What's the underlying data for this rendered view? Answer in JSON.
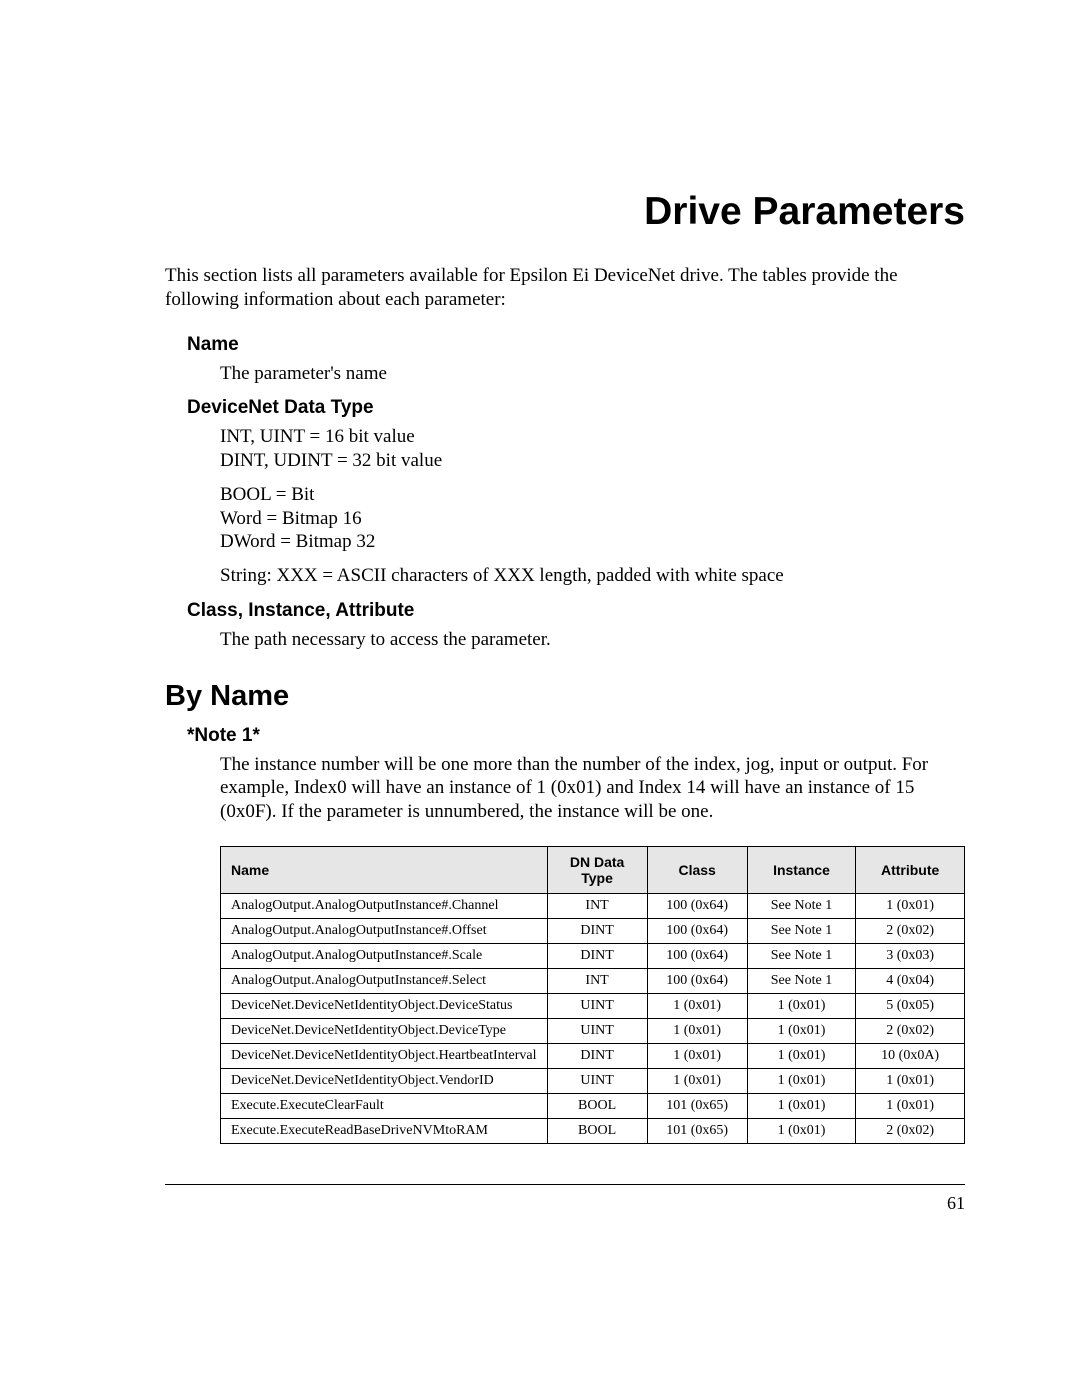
{
  "title": "Drive Parameters",
  "intro": "This section lists all parameters available for Epsilon Ei DeviceNet drive. The tables provide the following information about each parameter:",
  "sections": {
    "name": {
      "heading": "Name",
      "body": "The parameter's name"
    },
    "dataType": {
      "heading": "DeviceNet Data Type",
      "line1": "INT, UINT = 16 bit value",
      "line2": "DINT, UDINT = 32 bit value",
      "line3": "BOOL = Bit",
      "line4": "Word = Bitmap 16",
      "line5": "DWord = Bitmap 32",
      "line6": "String: XXX = ASCII characters of XXX length, padded with white space"
    },
    "cia": {
      "heading": "Class, Instance, Attribute",
      "body": "The path necessary to access the parameter."
    }
  },
  "byName": {
    "heading": "By Name",
    "noteHeading": "*Note 1*",
    "noteBody": "The instance number will be one more than the number of the index, jog, input or output. For example, Index0 will have an instance of 1 (0x01) and Index 14 will have an instance of 15 (0x0F). If the parameter is unnumbered, the instance will be one."
  },
  "tableHeaders": {
    "name": "Name",
    "type": "DN Data Type",
    "class": "Class",
    "instance": "Instance",
    "attribute": "Attribute"
  },
  "rows": [
    {
      "name": "AnalogOutput.AnalogOutputInstance#.Channel",
      "type": "INT",
      "class": "100 (0x64)",
      "instance": "See Note 1",
      "attribute": "1 (0x01)"
    },
    {
      "name": "AnalogOutput.AnalogOutputInstance#.Offset",
      "type": "DINT",
      "class": "100 (0x64)",
      "instance": "See Note 1",
      "attribute": "2 (0x02)"
    },
    {
      "name": "AnalogOutput.AnalogOutputInstance#.Scale",
      "type": "DINT",
      "class": "100 (0x64)",
      "instance": "See Note 1",
      "attribute": "3 (0x03)"
    },
    {
      "name": "AnalogOutput.AnalogOutputInstance#.Select",
      "type": "INT",
      "class": "100 (0x64)",
      "instance": "See Note 1",
      "attribute": "4 (0x04)"
    },
    {
      "name": "DeviceNet.DeviceNetIdentityObject.DeviceStatus",
      "type": "UINT",
      "class": "1 (0x01)",
      "instance": "1 (0x01)",
      "attribute": "5 (0x05)"
    },
    {
      "name": "DeviceNet.DeviceNetIdentityObject.DeviceType",
      "type": "UINT",
      "class": "1 (0x01)",
      "instance": "1 (0x01)",
      "attribute": "2 (0x02)"
    },
    {
      "name": "DeviceNet.DeviceNetIdentityObject.HeartbeatInterval",
      "type": "DINT",
      "class": "1 (0x01)",
      "instance": "1 (0x01)",
      "attribute": "10 (0x0A)"
    },
    {
      "name": "DeviceNet.DeviceNetIdentityObject.VendorID",
      "type": "UINT",
      "class": "1 (0x01)",
      "instance": "1 (0x01)",
      "attribute": "1 (0x01)"
    },
    {
      "name": "Execute.ExecuteClearFault",
      "type": "BOOL",
      "class": "101 (0x65)",
      "instance": "1 (0x01)",
      "attribute": "1 (0x01)"
    },
    {
      "name": "Execute.ExecuteReadBaseDriveNVMtoRAM",
      "type": "BOOL",
      "class": "101 (0x65)",
      "instance": "1 (0x01)",
      "attribute": "2 (0x02)"
    }
  ],
  "pageNumber": "61"
}
